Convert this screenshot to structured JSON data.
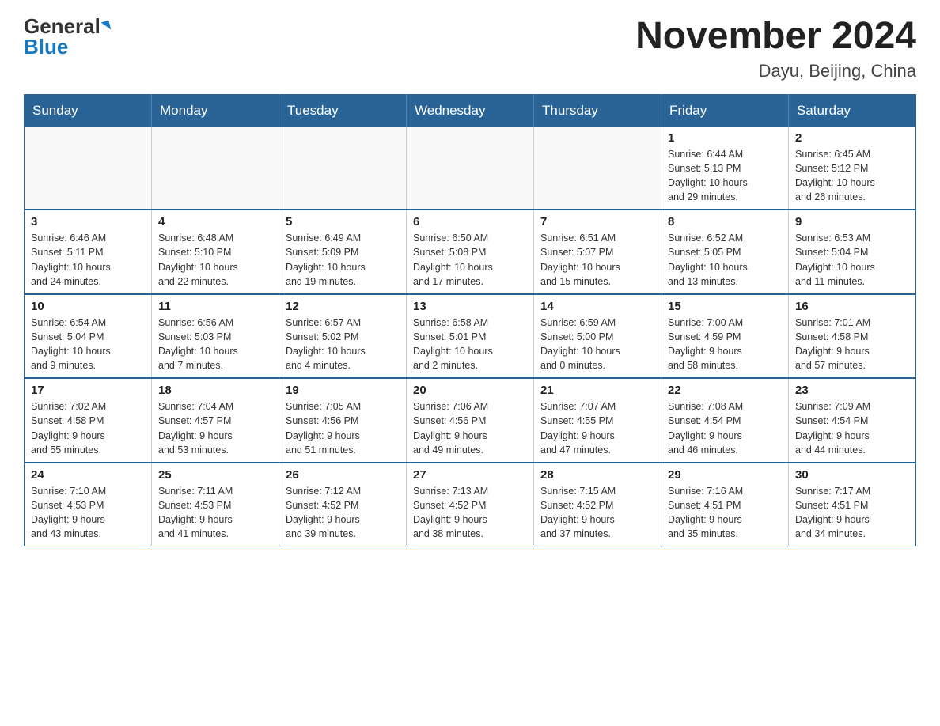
{
  "header": {
    "logo_general": "General",
    "logo_blue": "Blue",
    "month_year": "November 2024",
    "location": "Dayu, Beijing, China"
  },
  "weekdays": [
    "Sunday",
    "Monday",
    "Tuesday",
    "Wednesday",
    "Thursday",
    "Friday",
    "Saturday"
  ],
  "weeks": [
    [
      {
        "day": "",
        "info": ""
      },
      {
        "day": "",
        "info": ""
      },
      {
        "day": "",
        "info": ""
      },
      {
        "day": "",
        "info": ""
      },
      {
        "day": "",
        "info": ""
      },
      {
        "day": "1",
        "info": "Sunrise: 6:44 AM\nSunset: 5:13 PM\nDaylight: 10 hours\nand 29 minutes."
      },
      {
        "day": "2",
        "info": "Sunrise: 6:45 AM\nSunset: 5:12 PM\nDaylight: 10 hours\nand 26 minutes."
      }
    ],
    [
      {
        "day": "3",
        "info": "Sunrise: 6:46 AM\nSunset: 5:11 PM\nDaylight: 10 hours\nand 24 minutes."
      },
      {
        "day": "4",
        "info": "Sunrise: 6:48 AM\nSunset: 5:10 PM\nDaylight: 10 hours\nand 22 minutes."
      },
      {
        "day": "5",
        "info": "Sunrise: 6:49 AM\nSunset: 5:09 PM\nDaylight: 10 hours\nand 19 minutes."
      },
      {
        "day": "6",
        "info": "Sunrise: 6:50 AM\nSunset: 5:08 PM\nDaylight: 10 hours\nand 17 minutes."
      },
      {
        "day": "7",
        "info": "Sunrise: 6:51 AM\nSunset: 5:07 PM\nDaylight: 10 hours\nand 15 minutes."
      },
      {
        "day": "8",
        "info": "Sunrise: 6:52 AM\nSunset: 5:05 PM\nDaylight: 10 hours\nand 13 minutes."
      },
      {
        "day": "9",
        "info": "Sunrise: 6:53 AM\nSunset: 5:04 PM\nDaylight: 10 hours\nand 11 minutes."
      }
    ],
    [
      {
        "day": "10",
        "info": "Sunrise: 6:54 AM\nSunset: 5:04 PM\nDaylight: 10 hours\nand 9 minutes."
      },
      {
        "day": "11",
        "info": "Sunrise: 6:56 AM\nSunset: 5:03 PM\nDaylight: 10 hours\nand 7 minutes."
      },
      {
        "day": "12",
        "info": "Sunrise: 6:57 AM\nSunset: 5:02 PM\nDaylight: 10 hours\nand 4 minutes."
      },
      {
        "day": "13",
        "info": "Sunrise: 6:58 AM\nSunset: 5:01 PM\nDaylight: 10 hours\nand 2 minutes."
      },
      {
        "day": "14",
        "info": "Sunrise: 6:59 AM\nSunset: 5:00 PM\nDaylight: 10 hours\nand 0 minutes."
      },
      {
        "day": "15",
        "info": "Sunrise: 7:00 AM\nSunset: 4:59 PM\nDaylight: 9 hours\nand 58 minutes."
      },
      {
        "day": "16",
        "info": "Sunrise: 7:01 AM\nSunset: 4:58 PM\nDaylight: 9 hours\nand 57 minutes."
      }
    ],
    [
      {
        "day": "17",
        "info": "Sunrise: 7:02 AM\nSunset: 4:58 PM\nDaylight: 9 hours\nand 55 minutes."
      },
      {
        "day": "18",
        "info": "Sunrise: 7:04 AM\nSunset: 4:57 PM\nDaylight: 9 hours\nand 53 minutes."
      },
      {
        "day": "19",
        "info": "Sunrise: 7:05 AM\nSunset: 4:56 PM\nDaylight: 9 hours\nand 51 minutes."
      },
      {
        "day": "20",
        "info": "Sunrise: 7:06 AM\nSunset: 4:56 PM\nDaylight: 9 hours\nand 49 minutes."
      },
      {
        "day": "21",
        "info": "Sunrise: 7:07 AM\nSunset: 4:55 PM\nDaylight: 9 hours\nand 47 minutes."
      },
      {
        "day": "22",
        "info": "Sunrise: 7:08 AM\nSunset: 4:54 PM\nDaylight: 9 hours\nand 46 minutes."
      },
      {
        "day": "23",
        "info": "Sunrise: 7:09 AM\nSunset: 4:54 PM\nDaylight: 9 hours\nand 44 minutes."
      }
    ],
    [
      {
        "day": "24",
        "info": "Sunrise: 7:10 AM\nSunset: 4:53 PM\nDaylight: 9 hours\nand 43 minutes."
      },
      {
        "day": "25",
        "info": "Sunrise: 7:11 AM\nSunset: 4:53 PM\nDaylight: 9 hours\nand 41 minutes."
      },
      {
        "day": "26",
        "info": "Sunrise: 7:12 AM\nSunset: 4:52 PM\nDaylight: 9 hours\nand 39 minutes."
      },
      {
        "day": "27",
        "info": "Sunrise: 7:13 AM\nSunset: 4:52 PM\nDaylight: 9 hours\nand 38 minutes."
      },
      {
        "day": "28",
        "info": "Sunrise: 7:15 AM\nSunset: 4:52 PM\nDaylight: 9 hours\nand 37 minutes."
      },
      {
        "day": "29",
        "info": "Sunrise: 7:16 AM\nSunset: 4:51 PM\nDaylight: 9 hours\nand 35 minutes."
      },
      {
        "day": "30",
        "info": "Sunrise: 7:17 AM\nSunset: 4:51 PM\nDaylight: 9 hours\nand 34 minutes."
      }
    ]
  ]
}
